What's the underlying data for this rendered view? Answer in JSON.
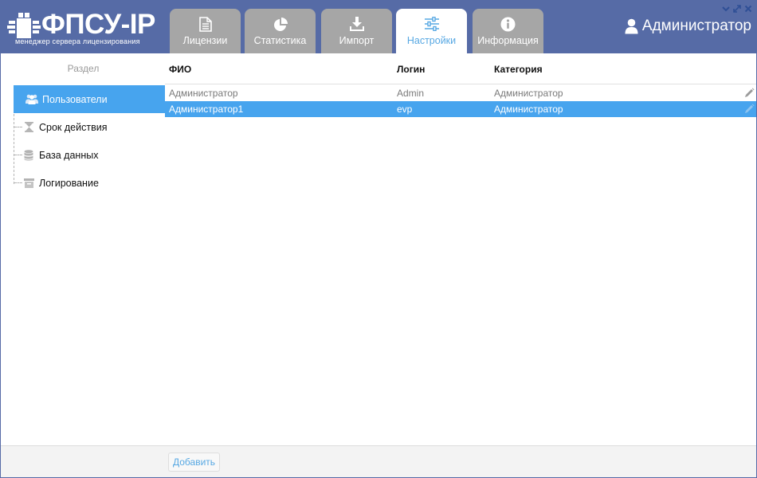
{
  "app": {
    "logo_title": "ФПСУ-IP",
    "logo_subtitle": "менеджер сервера лицензирования"
  },
  "tabs": [
    {
      "label": "Лицензии",
      "icon": "document-icon",
      "active": false
    },
    {
      "label": "Статистика",
      "icon": "pie-chart-icon",
      "active": false
    },
    {
      "label": "Импорт",
      "icon": "download-icon",
      "active": false
    },
    {
      "label": "Настройки",
      "icon": "sliders-icon",
      "active": true
    },
    {
      "label": "Информация",
      "icon": "info-icon",
      "active": false
    }
  ],
  "window_controls": [
    "minimize-icon",
    "maximize-icon",
    "close-icon"
  ],
  "user": {
    "name": "Администратор",
    "icon": "user-icon"
  },
  "sidebar": {
    "header": "Раздел",
    "items": [
      {
        "label": "Пользователи",
        "icon": "users-icon",
        "active": true
      },
      {
        "label": "Срок действия",
        "icon": "hourglass-icon",
        "active": false
      },
      {
        "label": "База данных",
        "icon": "database-icon",
        "active": false
      },
      {
        "label": "Логирование",
        "icon": "log-icon",
        "active": false
      }
    ]
  },
  "table": {
    "columns": [
      "ФИО",
      "Логин",
      "Категория"
    ],
    "rows": [
      {
        "name": "Администратор",
        "login": "Admin",
        "category": "Администратор",
        "selected": false
      },
      {
        "name": "Администратор1",
        "login": "evp",
        "category": "Администратор",
        "selected": true
      }
    ]
  },
  "footer": {
    "add_label": "Добавить"
  },
  "colors": {
    "header_bg": "#566ba6",
    "accent": "#47a4ee",
    "active_tab_text": "#57a8e3",
    "inactive_tab": "#a6a6a6"
  }
}
